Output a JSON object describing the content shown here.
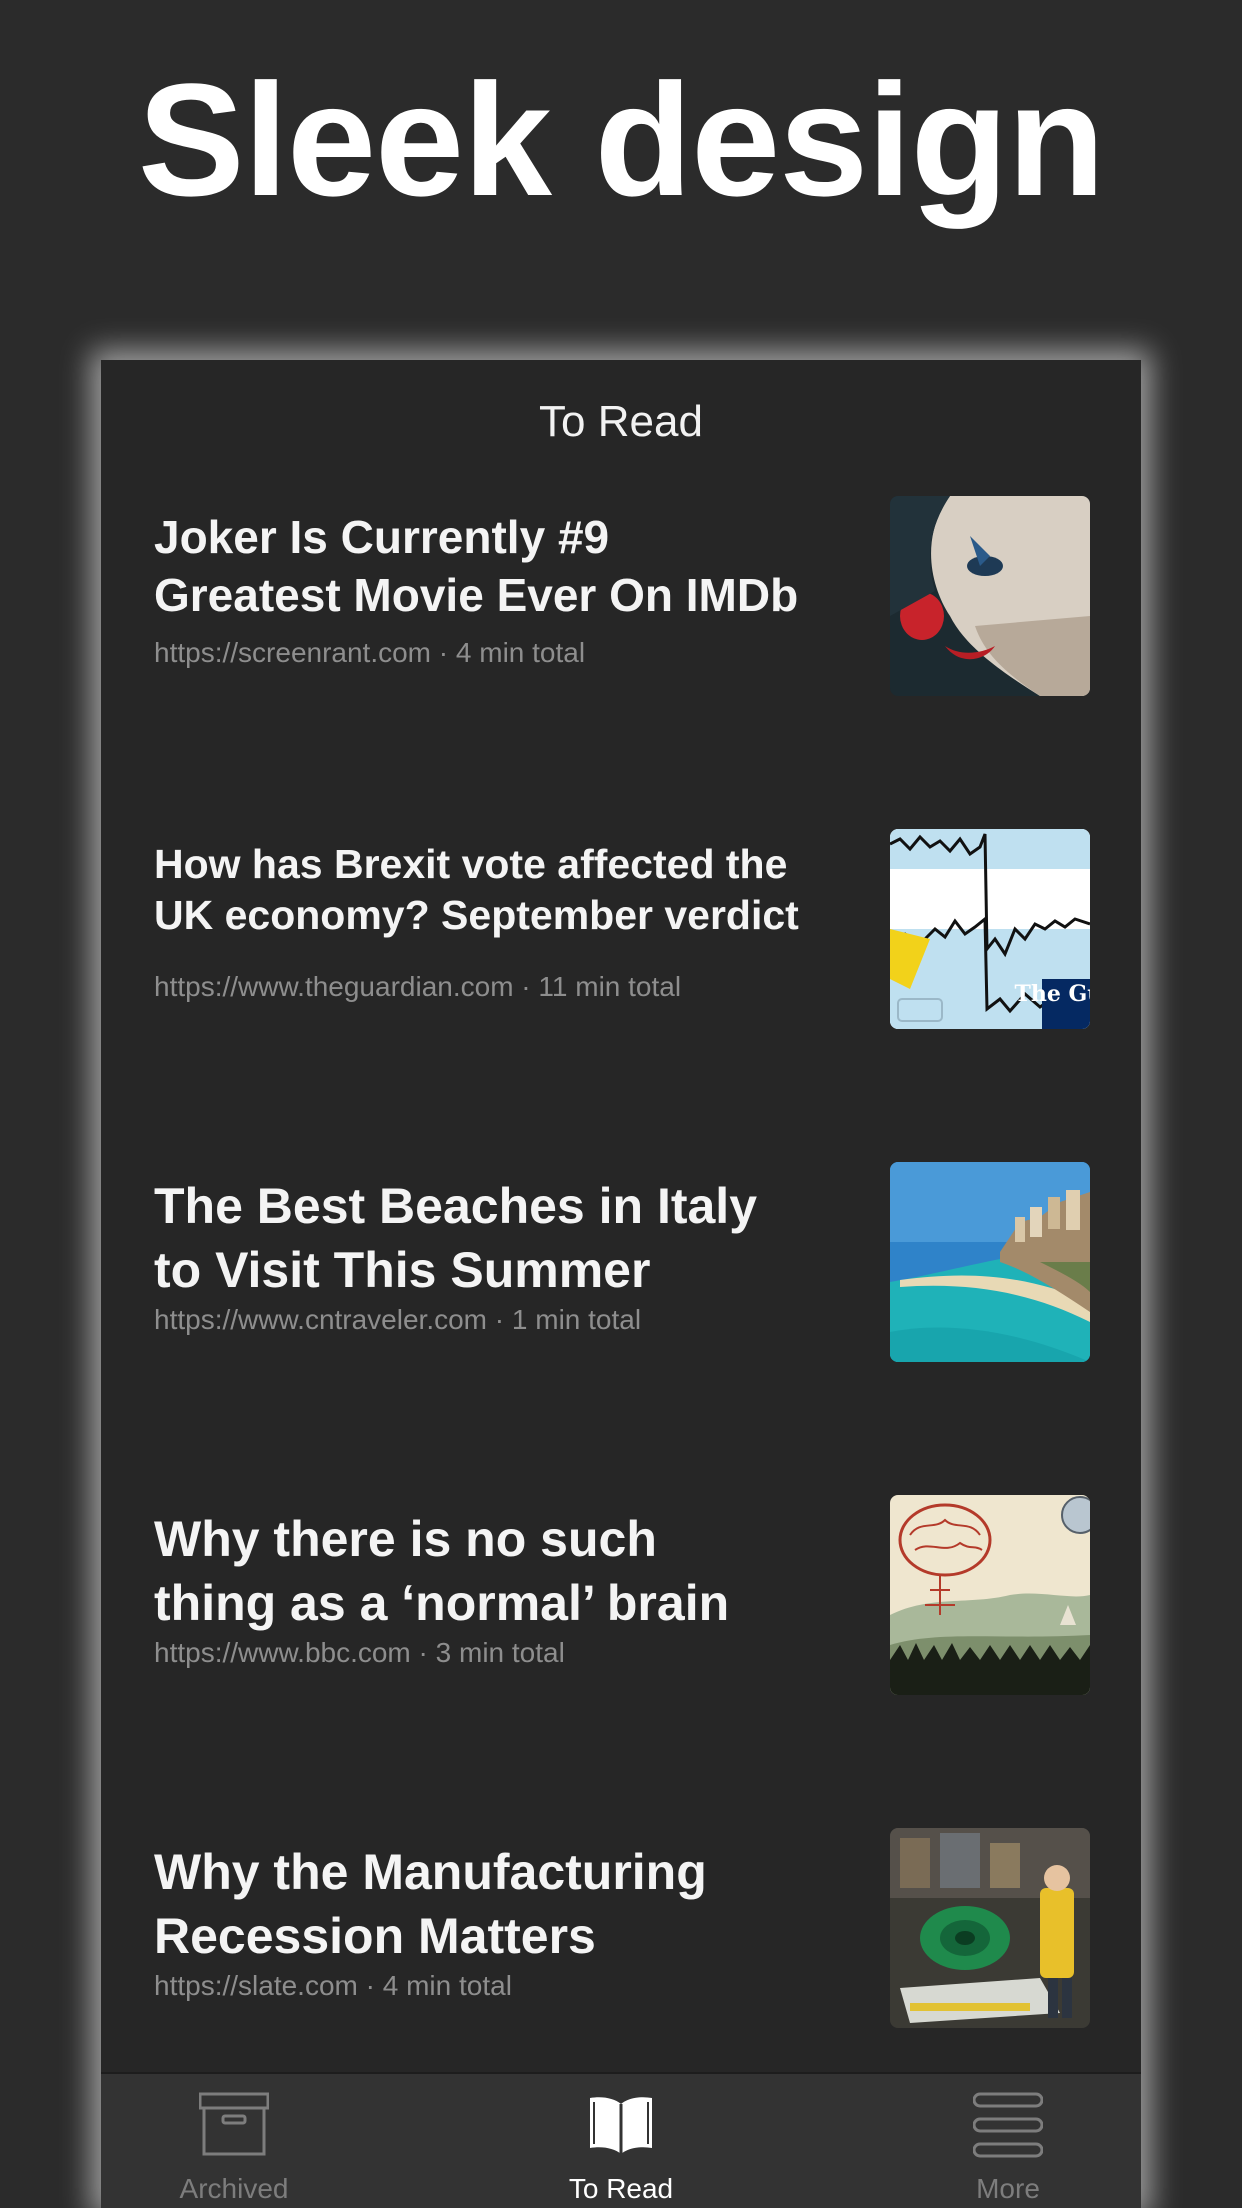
{
  "hero": {
    "title": "Sleek design"
  },
  "screen": {
    "nav_title": "To Read"
  },
  "articles": [
    {
      "title_line1": "Joker Is Currently #9",
      "title_line2": "Greatest Movie Ever On IMDb",
      "meta": "https://screenrant.com · 4 min total",
      "thumbnail_icon": "joker-face-image"
    },
    {
      "title_line1": "How has Brexit vote affected the",
      "title_line2": "UK economy? September verdict",
      "meta": "https://www.theguardian.com · 11 min total",
      "thumbnail_icon": "economy-chart-image",
      "thumbnail_badge": "The Gua"
    },
    {
      "title_line1": "The Best Beaches in Italy",
      "title_line2": "to Visit This Summer",
      "meta": "https://www.cntraveler.com · 1 min total",
      "thumbnail_icon": "italian-beach-image"
    },
    {
      "title_line1": "Why there is no such",
      "title_line2": "thing as a ‘normal’ brain",
      "meta": "https://www.bbc.com · 3 min total",
      "thumbnail_icon": "brain-illustration-image"
    },
    {
      "title_line1": "Why the Manufacturing",
      "title_line2": "Recession Matters",
      "meta": "https://slate.com · 4 min total",
      "thumbnail_icon": "factory-machinery-image"
    }
  ],
  "tabbar": {
    "tabs": [
      {
        "label": "Archived",
        "icon": "archive-box-icon",
        "active": false
      },
      {
        "label": "To Read",
        "icon": "open-book-icon",
        "active": true
      },
      {
        "label": "More",
        "icon": "stacked-lines-icon",
        "active": false
      }
    ]
  },
  "colors": {
    "background": "#2b2b2b",
    "screen": "#262626",
    "tabbar": "#333333",
    "text_primary": "#f4f4f4",
    "text_secondary": "#8e8e8e",
    "tab_inactive": "#7d7d7d"
  }
}
